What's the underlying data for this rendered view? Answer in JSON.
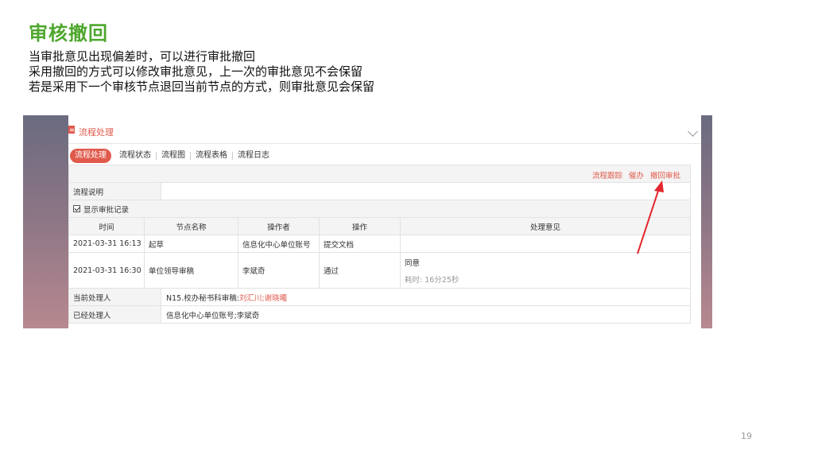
{
  "slide": {
    "title": "审核撤回",
    "lines": [
      "当审批意见出现偏差时，可以进行审批撤回",
      "采用撤回的方式可以修改审批意见，上一次的审批意见不会保留",
      "若是采用下一个审核节点退回当前节点的方式，则审批意见会保留"
    ],
    "page_number": "19"
  },
  "panel": {
    "title": "流程处理",
    "tabs": [
      "流程处理",
      "流程状态",
      "流程图",
      "流程表格",
      "流程日志"
    ],
    "actions": [
      "流程跟踪",
      "催办",
      "撤回审批"
    ],
    "desc_label": "流程说明",
    "desc_value": "",
    "show_records_label": "显示审批记录",
    "table": {
      "headers": [
        "时间",
        "节点名称",
        "操作者",
        "操作",
        "处理意见"
      ],
      "rows": [
        {
          "time": "2021-03-31 16:13",
          "node": "起草",
          "operator": "信息化中心单位账号",
          "action": "提交文档",
          "opinion": "",
          "duration": ""
        },
        {
          "time": "2021-03-31 16:30",
          "node": "单位领导审稿",
          "operator": "李斌奇",
          "action": "通过",
          "opinion": "同意",
          "duration": "耗时: 16分25秒"
        }
      ]
    },
    "current_label": "当前处理人",
    "current_node": "N15.校办秘书科审稿:",
    "current_people": "刘汇川;谢晓曦",
    "done_label": "已经处理人",
    "done_value": "信息化中心单位账号;李斌奇"
  },
  "colors": {
    "title_green": "#4ea72e",
    "accent_red": "#e05a4c"
  }
}
